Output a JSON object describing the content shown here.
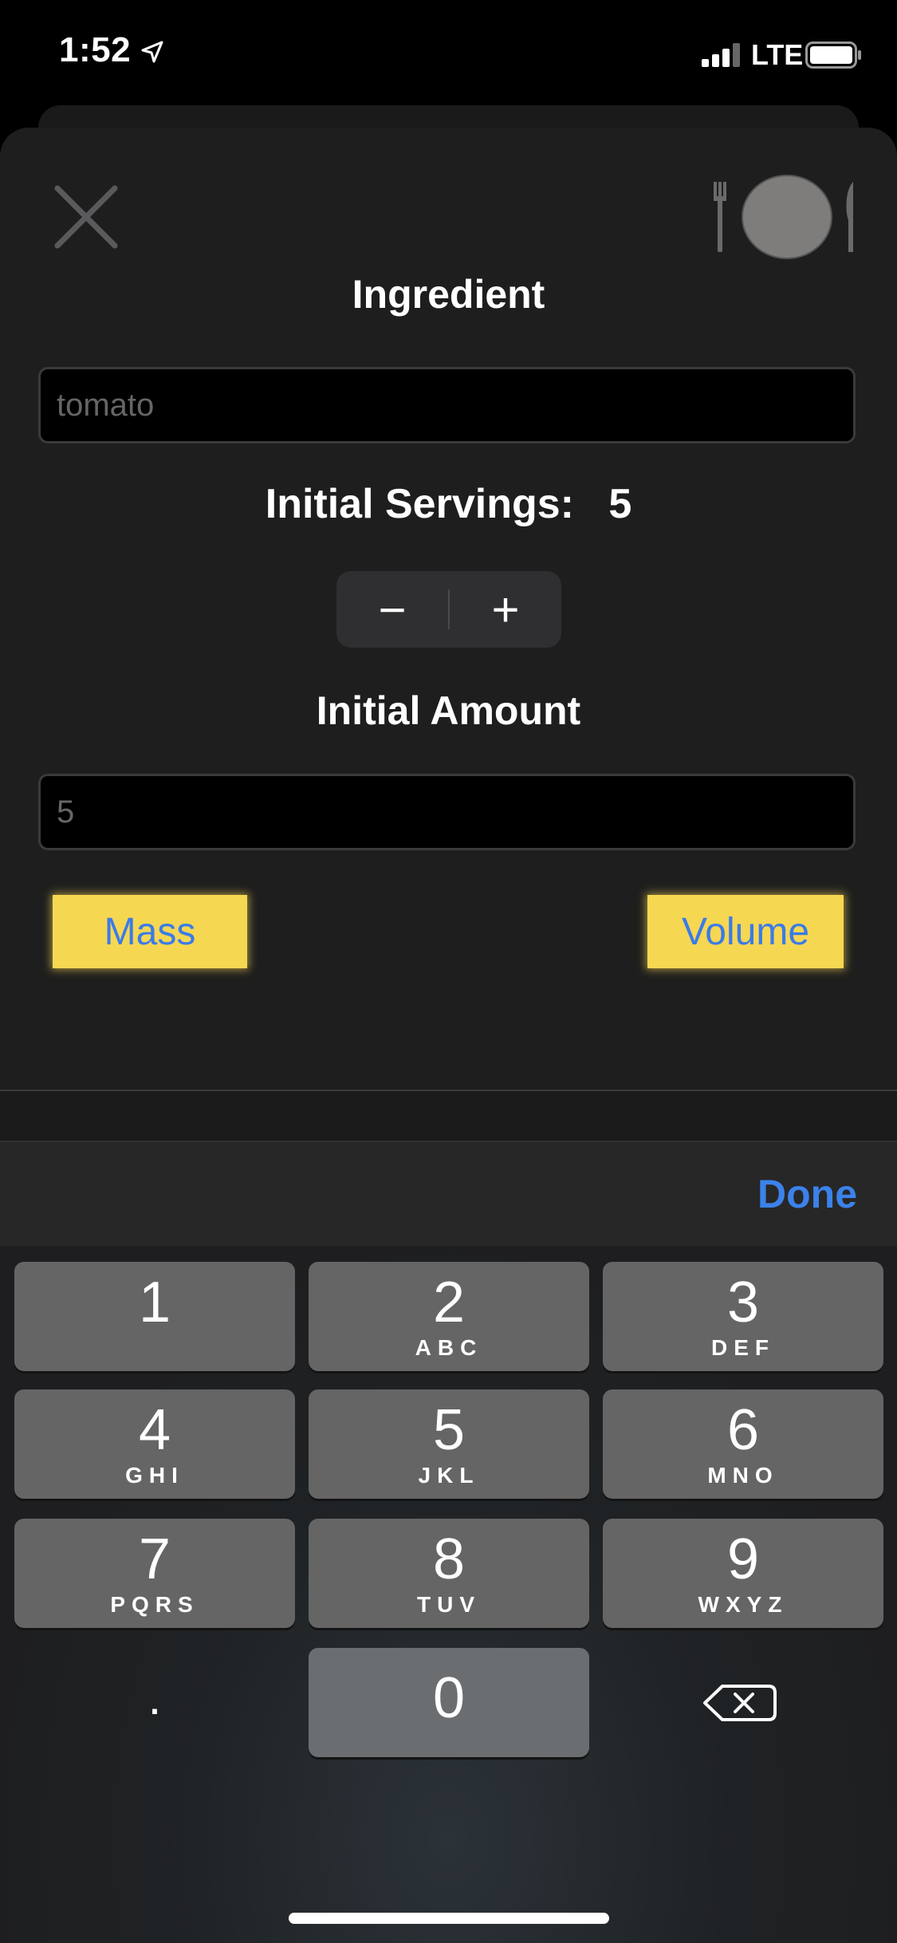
{
  "status_bar": {
    "time": "1:52",
    "carrier": "LTE"
  },
  "form": {
    "ingredient_title": "Ingredient",
    "ingredient_placeholder": "tomato",
    "servings_label": "Initial Servings:",
    "servings_value": "5",
    "minus_symbol": "−",
    "plus_symbol": "+",
    "amount_title": "Initial Amount",
    "amount_placeholder": "5",
    "mass_label": "Mass",
    "volume_label": "Volume"
  },
  "keyboard": {
    "done_label": "Done",
    "keys": [
      {
        "digit": "1",
        "letters": ""
      },
      {
        "digit": "2",
        "letters": "ABC"
      },
      {
        "digit": "3",
        "letters": "DEF"
      },
      {
        "digit": "4",
        "letters": "GHI"
      },
      {
        "digit": "5",
        "letters": "JKL"
      },
      {
        "digit": "6",
        "letters": "MNO"
      },
      {
        "digit": "7",
        "letters": "PQRS"
      },
      {
        "digit": "8",
        "letters": "TUV"
      },
      {
        "digit": "9",
        "letters": "WXYZ"
      },
      {
        "digit": "0",
        "letters": ""
      }
    ],
    "decimal": "."
  },
  "colors": {
    "accent_blue": "#3b82ea",
    "button_yellow": "#f6d752",
    "sheet_bg": "#1e1e1e"
  },
  "icons": [
    "close-icon",
    "cutlery-icon",
    "location-arrow-icon",
    "signal-icon",
    "battery-icon",
    "backspace-icon"
  ]
}
